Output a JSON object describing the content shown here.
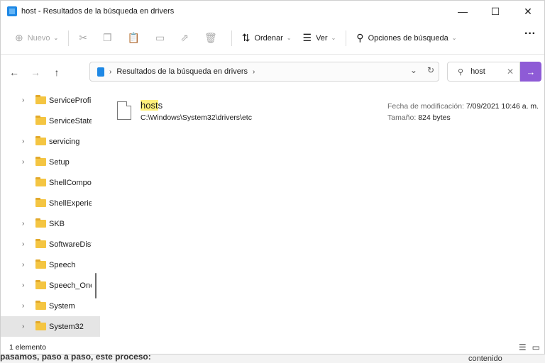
{
  "window": {
    "title": "host - Resultados de la búsqueda en drivers"
  },
  "win_controls": {
    "minimize": "—",
    "maximize": "☐",
    "close": "✕"
  },
  "toolbar": {
    "new_label": "Nuevo",
    "sort_label": "Ordenar",
    "view_label": "Ver",
    "search_options_label": "Opciones de búsqueda",
    "more_label": "···"
  },
  "address": {
    "path": "Resultados de la búsqueda en drivers"
  },
  "search": {
    "value": "host"
  },
  "sidebar": {
    "items": [
      {
        "label": "ServiceProfil",
        "expandable": true
      },
      {
        "label": "ServiceState",
        "expandable": false
      },
      {
        "label": "servicing",
        "expandable": true
      },
      {
        "label": "Setup",
        "expandable": true
      },
      {
        "label": "ShellCompo",
        "expandable": false
      },
      {
        "label": "ShellExperie",
        "expandable": false
      },
      {
        "label": "SKB",
        "expandable": true
      },
      {
        "label": "SoftwareDist",
        "expandable": true
      },
      {
        "label": "Speech",
        "expandable": true
      },
      {
        "label": "Speech_One",
        "expandable": true
      },
      {
        "label": "System",
        "expandable": true
      },
      {
        "label": "System32",
        "expandable": true,
        "selected": true
      }
    ]
  },
  "result": {
    "name_highlight": "host",
    "name_rest": "s",
    "path": "C:\\Windows\\System32\\drivers\\etc",
    "modified_label": "Fecha de modificación:",
    "modified_value": "7/09/2021 10:46 a. m.",
    "size_label": "Tamaño:",
    "size_value": "824 bytes"
  },
  "status": {
    "text": "1 elemento"
  },
  "background": {
    "article_text": "pasamos, paso a paso, este proceso:",
    "side_text": "contenido"
  },
  "colors": {
    "accent": "#8e5bd6",
    "highlight": "#fff07a",
    "folder": "#f4c542"
  }
}
